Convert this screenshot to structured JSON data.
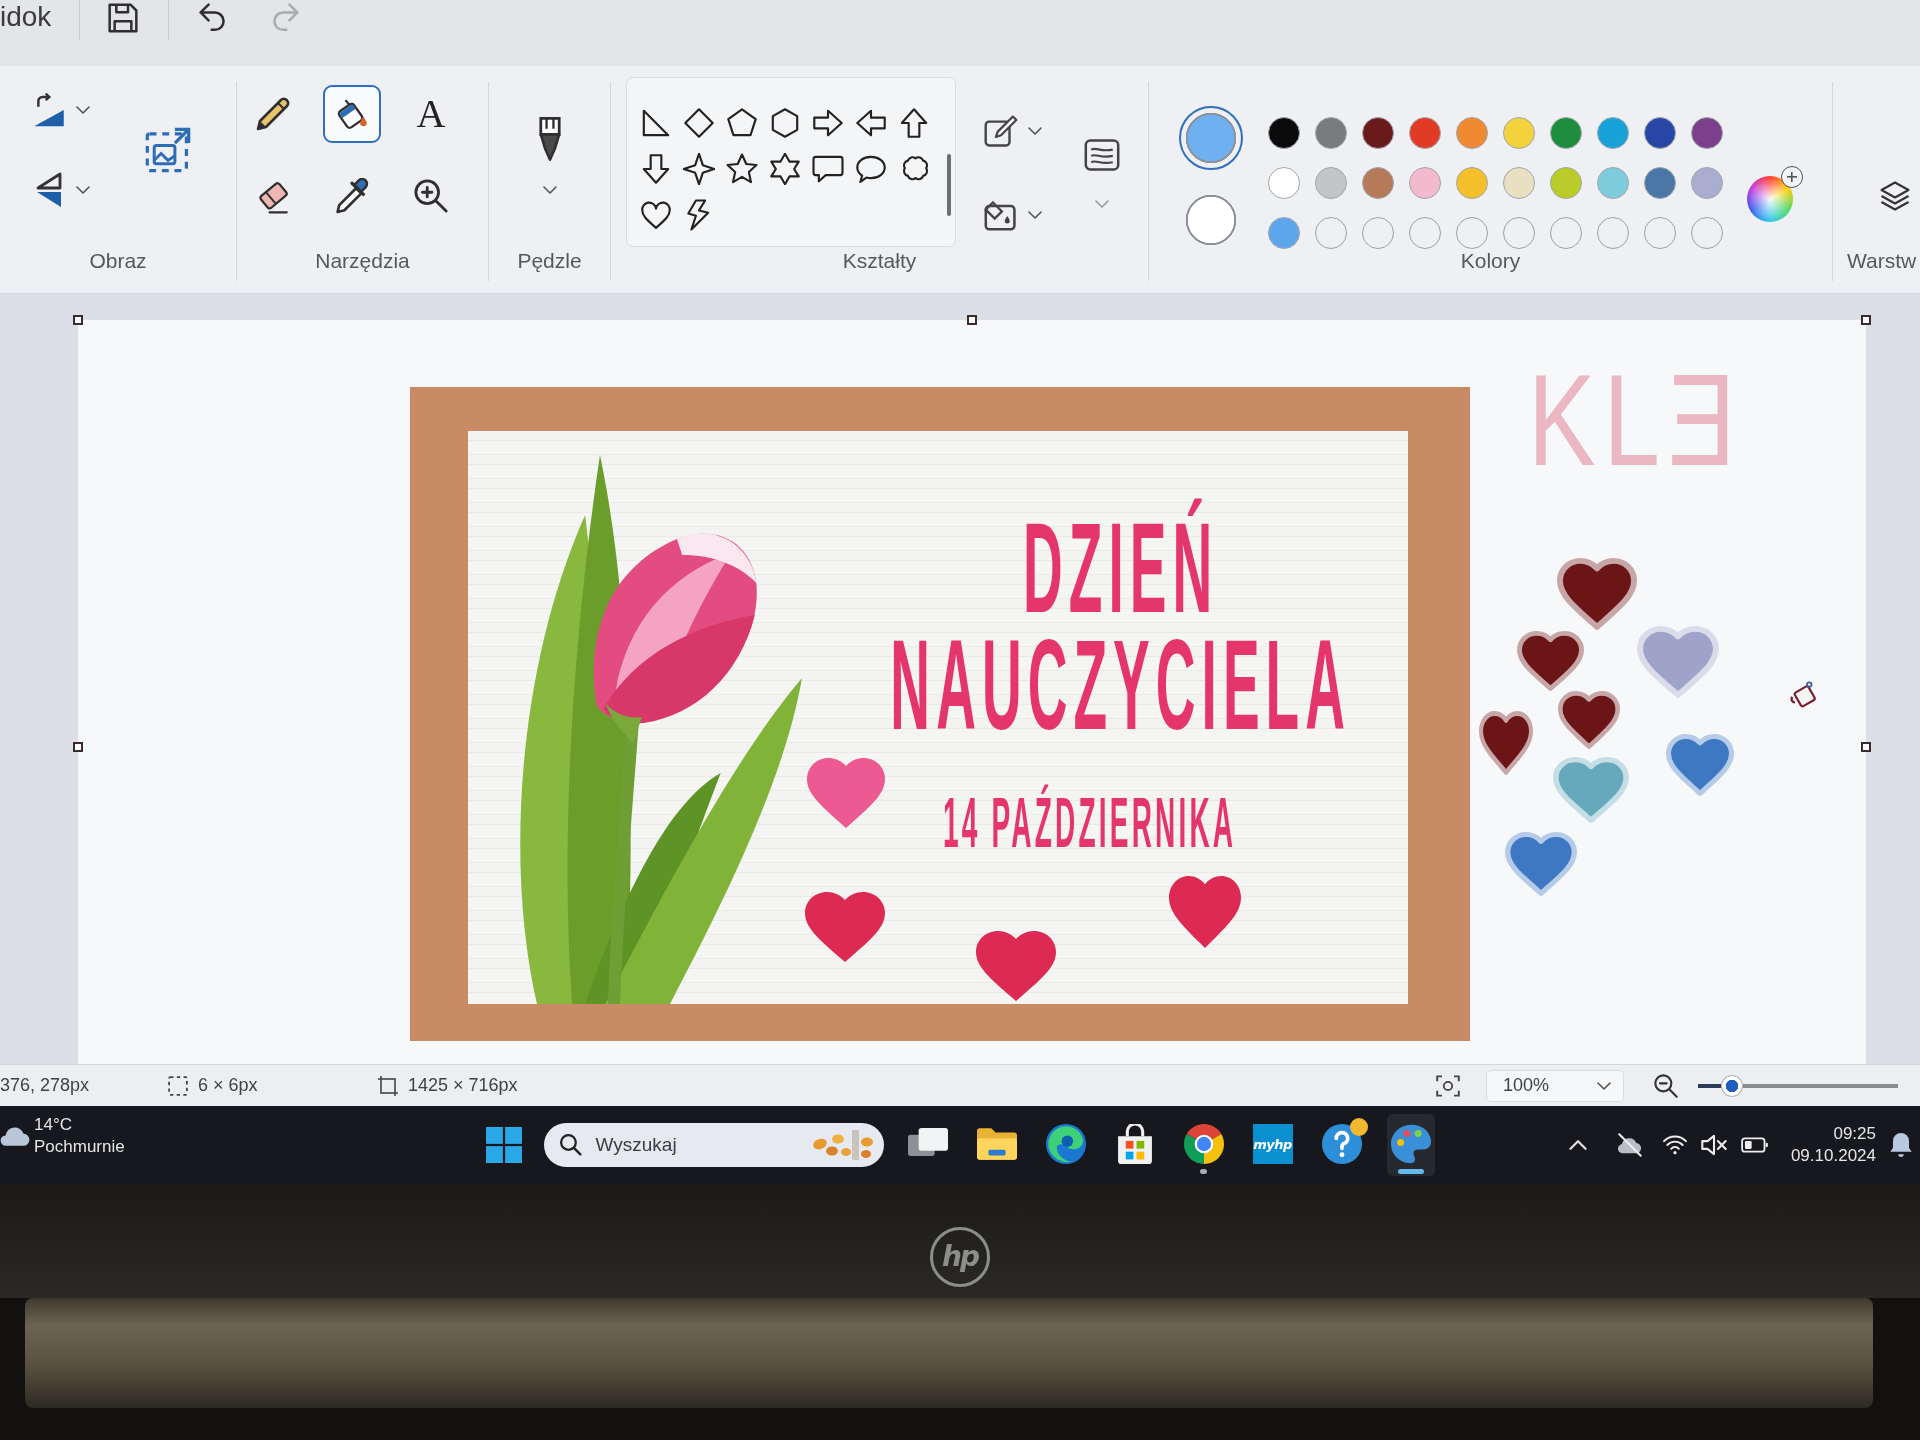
{
  "quick_access": {
    "menu_tab": "idok",
    "buttons": [
      {
        "disabled": false
      },
      {
        "disabled": false
      },
      {
        "disabled": true
      }
    ]
  },
  "ribbon": {
    "image_group": {
      "label": "Obraz"
    },
    "tools_group": {
      "label": "Narzędzia",
      "tools": [
        {
          "selected": false
        },
        {
          "selected": true
        },
        {
          "glyph": "A",
          "selected": false
        },
        {
          "selected": false
        },
        {
          "selected": false
        },
        {
          "selected": false
        }
      ]
    },
    "brushes_group": {
      "label": "Pędzle"
    },
    "shapes_group": {
      "label": "Kształty"
    },
    "colors_group": {
      "label": "Kolory",
      "current": [
        {
          "color": "#6eb0f0",
          "selected": true
        },
        {
          "color": "#ffffff",
          "selected": false
        }
      ],
      "palette": [
        {
          "color": "#0b0b0b"
        },
        {
          "color": "#7a7b7d"
        },
        {
          "color": "#6b1a1c"
        },
        {
          "color": "#e23b25"
        },
        {
          "color": "#f08a32"
        },
        {
          "color": "#f2d33c"
        },
        {
          "color": "#1f8d3e"
        },
        {
          "color": "#18a2d8"
        },
        {
          "color": "#2746a6"
        },
        {
          "color": "#7b3f8b"
        },
        {
          "color": "#ffffff"
        },
        {
          "color": "#c4c5c7"
        },
        {
          "color": "#b57a58"
        },
        {
          "color": "#f3b9cd"
        },
        {
          "color": "#f5bf2a"
        },
        {
          "color": "#e9e0c2"
        },
        {
          "color": "#b9cc2a"
        },
        {
          "color": "#7ecbdc"
        },
        {
          "color": "#4a77a6"
        },
        {
          "color": "#aaadd0"
        }
      ],
      "custom": [
        {
          "kind": "filled",
          "color": "#5ea6ec"
        },
        {
          "kind": "empty"
        },
        {
          "kind": "empty"
        },
        {
          "kind": "empty"
        },
        {
          "kind": "empty"
        },
        {
          "kind": "empty"
        },
        {
          "kind": "empty"
        },
        {
          "kind": "empty"
        },
        {
          "kind": "empty"
        },
        {
          "kind": "empty"
        }
      ]
    },
    "layers_group": {
      "label": "Warstw"
    }
  },
  "canvas": {
    "card": {
      "title": "DZIEŃ NAUCZYCIELA",
      "date": "14 PAŹDZIERNIKA"
    },
    "doodle": "KLƎ",
    "hearts": [
      {
        "color": "#6c1517"
      },
      {
        "color": "#6c1517"
      },
      {
        "color": "#9fa3c9"
      },
      {
        "color": "#6c1517"
      },
      {
        "color": "#6c1517"
      },
      {
        "color": "#66a9bd"
      },
      {
        "color": "#3e77c2"
      },
      {
        "color": "#3e77c2"
      }
    ]
  },
  "status_bar": {
    "cursor_position": "376, 278px",
    "selection_size": "6 × 6px",
    "canvas_size": "1425 × 716px",
    "zoom": "100%",
    "zoom_slider": {
      "level": 0.13
    }
  },
  "taskbar": {
    "weather": {
      "temperature": "14°C",
      "condition": "Pochmurnie"
    },
    "search": {
      "placeholder": "Wyszukaj"
    },
    "apps": [
      {
        "running": false,
        "active": false,
        "badge": false
      },
      {
        "running": false,
        "active": false,
        "badge": false
      },
      {
        "running": false,
        "active": false,
        "badge": false
      },
      {
        "running": false,
        "active": false,
        "badge": false
      },
      {
        "running": true,
        "active": false,
        "badge": false
      },
      {
        "label": "myhp",
        "running": false,
        "active": false,
        "badge": false
      },
      {
        "running": false,
        "active": false,
        "badge": true
      },
      {
        "running": true,
        "active": true,
        "badge": false
      }
    ],
    "tray": {
      "muted": true
    },
    "clock": {
      "time": "09:25",
      "date": "09.10.2024"
    }
  },
  "laptop": {
    "logo": "hp"
  }
}
